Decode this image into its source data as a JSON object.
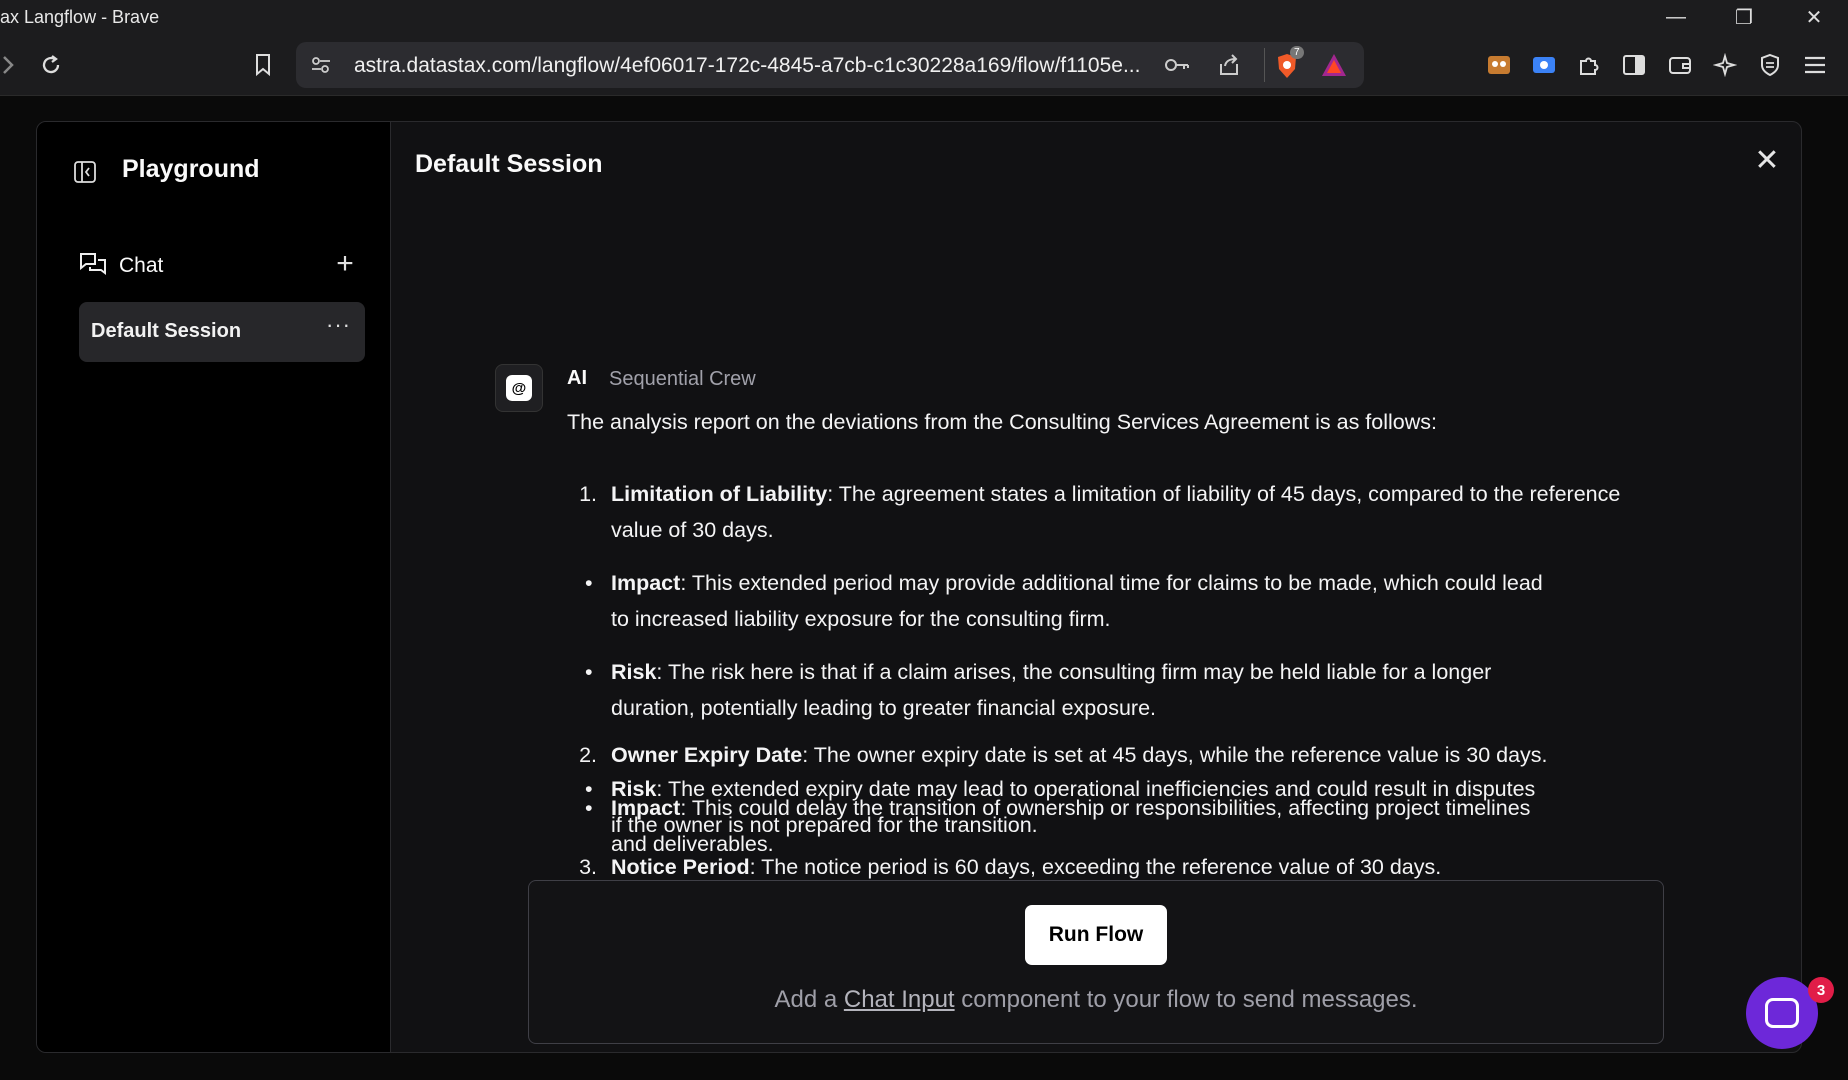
{
  "browser": {
    "window_title": "ax Langflow - Brave",
    "url": "astra.datastax.com/langflow/4ef06017-172c-4845-a7cb-c1c30228a169/flow/f1105e...",
    "shield_count": "7",
    "controls": {
      "minimize": "—",
      "restore": "❐",
      "close": "✕"
    }
  },
  "sidebar": {
    "title": "Playground",
    "section_label": "Chat",
    "add_label": "+",
    "sessions": [
      {
        "label": "Default Session",
        "more": "···"
      }
    ]
  },
  "main": {
    "title": "Default Session",
    "close_label": "✕"
  },
  "message": {
    "sender": "AI",
    "sender_sub": "Sequential Crew",
    "avatar_glyph": "@",
    "intro": "The analysis report on the deviations from the Consulting Services Agreement is as follows:",
    "items": [
      {
        "num": "1.",
        "title": "Limitation of Liability",
        "text": ": The agreement states a limitation of liability of 45 days, compared to the reference value of 30 days.",
        "bullets": [
          {
            "title": "Impact",
            "text": ": This extended period may provide additional time for claims to be made, which could lead to increased liability exposure for the consulting firm."
          },
          {
            "title": "Risk",
            "text": ": The risk here is that if a claim arises, the consulting firm may be held liable for a longer duration, potentially leading to greater financial exposure."
          }
        ]
      },
      {
        "num": "2.",
        "title": "Owner Expiry Date",
        "text": ": The owner expiry date is set at 45 days, while the reference value is 30 days.",
        "bullets": [
          {
            "title": "Impact",
            "text": ": This could delay the transition of ownership or responsibilities, affecting project timelines and deliverables."
          },
          {
            "title": "Risk",
            "text": ": The extended expiry date may lead to operational inefficiencies and could result in disputes if the owner is not prepared for the transition."
          }
        ]
      },
      {
        "num": "3.",
        "title": "Notice Period",
        "text": ": The notice period is 60 days, exceeding the reference value of 30 days.",
        "bullets": []
      }
    ]
  },
  "input": {
    "run_button": "Run Flow",
    "hint_prefix": "Add a ",
    "hint_link": "Chat Input",
    "hint_suffix": " component to your flow to send messages."
  },
  "intercom": {
    "badge": "3"
  }
}
